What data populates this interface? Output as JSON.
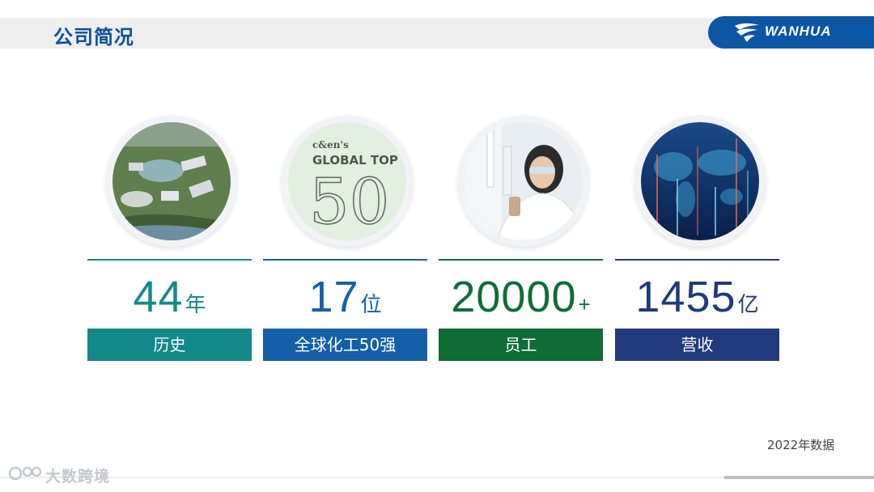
{
  "header": {
    "title": "公司简况",
    "logo_text": "WANHUA"
  },
  "cards": [
    {
      "number": "44",
      "unit": "年",
      "label": "历史",
      "color": "#13898a",
      "image": "aerial-campus-image"
    },
    {
      "number": "17",
      "unit": "位",
      "label": "全球化工50强",
      "color": "#1460a8",
      "image": "global-top-50-image",
      "image_text": {
        "brand": "c&en's",
        "line": "GLOBAL TOP",
        "big": "50"
      }
    },
    {
      "number": "20000",
      "unit": "+",
      "label": "员工",
      "color": "#0f6d35",
      "image": "lab-scientist-image"
    },
    {
      "number": "1455",
      "unit": "亿",
      "label": "营收",
      "color": "#203a7d",
      "image": "world-data-map-image"
    }
  ],
  "footnote": "2022年数据",
  "watermark": "大数跨境"
}
